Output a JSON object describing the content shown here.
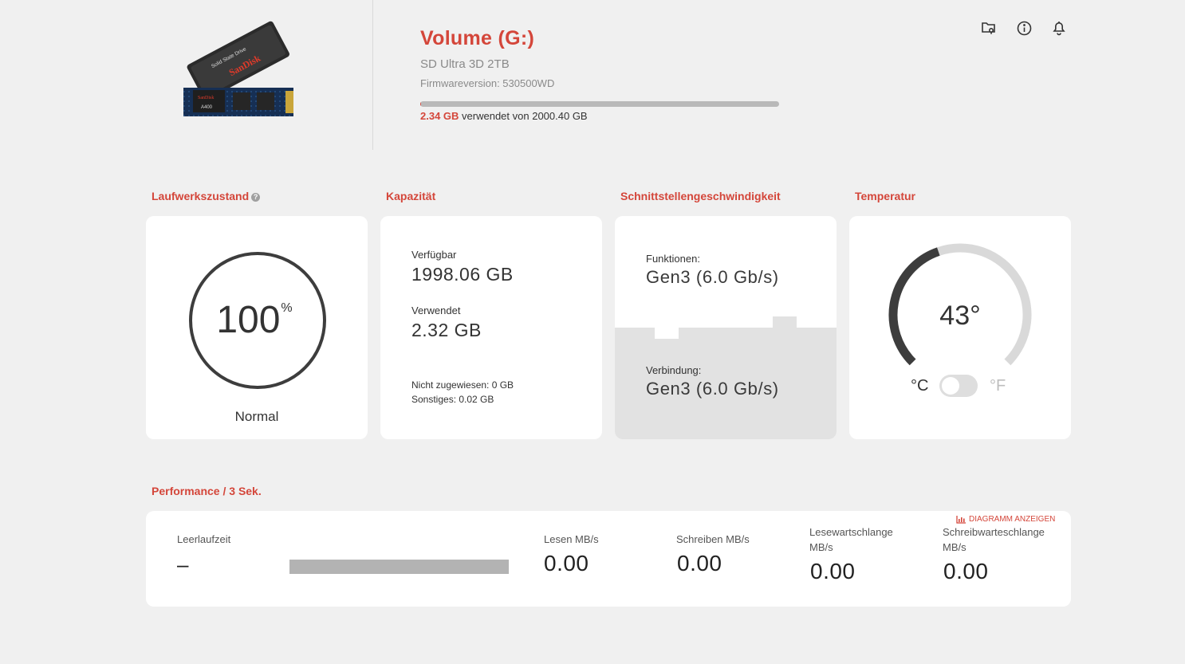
{
  "header": {
    "title": "Volume (G:)",
    "model": "SD Ultra 3D 2TB",
    "firmware": "Firmwareversion: 530500WD",
    "used_value": "2.34 GB",
    "used_suffix": "verwendet von 2000.40 GB",
    "used_fraction": 0.0012,
    "product_image_text": [
      "Solid State Drive",
      "SanDisk",
      "A400"
    ]
  },
  "top_icons": [
    "folder-location-icon",
    "info-icon",
    "bell-icon"
  ],
  "sections": {
    "health": {
      "label": "Laufwerkszustand",
      "value": "100",
      "unit": "%",
      "status": "Normal"
    },
    "capacity": {
      "label": "Kapazität",
      "available_label": "Verfügbar",
      "available_value": "1998.06 GB",
      "used_label": "Verwendet",
      "used_value": "2.32 GB",
      "unallocated": "Nicht zugewiesen: 0 GB",
      "other": "Sonstiges: 0.02 GB"
    },
    "interface": {
      "label": "Schnittstellengeschwindigkeit",
      "capability_label": "Funktionen:",
      "capability_value": "Gen3 (6.0 Gb/s)",
      "connection_label": "Verbindung:",
      "connection_value": "Gen3 (6.0 Gb/s)"
    },
    "temperature": {
      "label": "Temperatur",
      "value": "43°",
      "celsius": "°C",
      "fahrenheit": "°F",
      "gauge_fraction": 0.43
    },
    "performance": {
      "label": "Performance / 3 Sek.",
      "chart_link": "DIAGRAMM ANZEIGEN",
      "idle_label": "Leerlaufzeit",
      "idle_value": "–",
      "read_label": "Lesen MB/s",
      "read_value": "0.00",
      "write_label": "Schreiben MB/s",
      "write_value": "0.00",
      "read_queue_label_1": "Lesewartschlange",
      "read_queue_label_2": "MB/s",
      "read_queue_value": "0.00",
      "write_queue_label_1": "Schreibwarteschlange",
      "write_queue_label_2": "MB/s",
      "write_queue_value": "0.00"
    }
  },
  "colors": {
    "accent": "#d4463a",
    "background": "#f0f0f0",
    "card": "#ffffff",
    "gauge_dark": "#3d3d3d",
    "gauge_light": "#d9d9d9"
  }
}
